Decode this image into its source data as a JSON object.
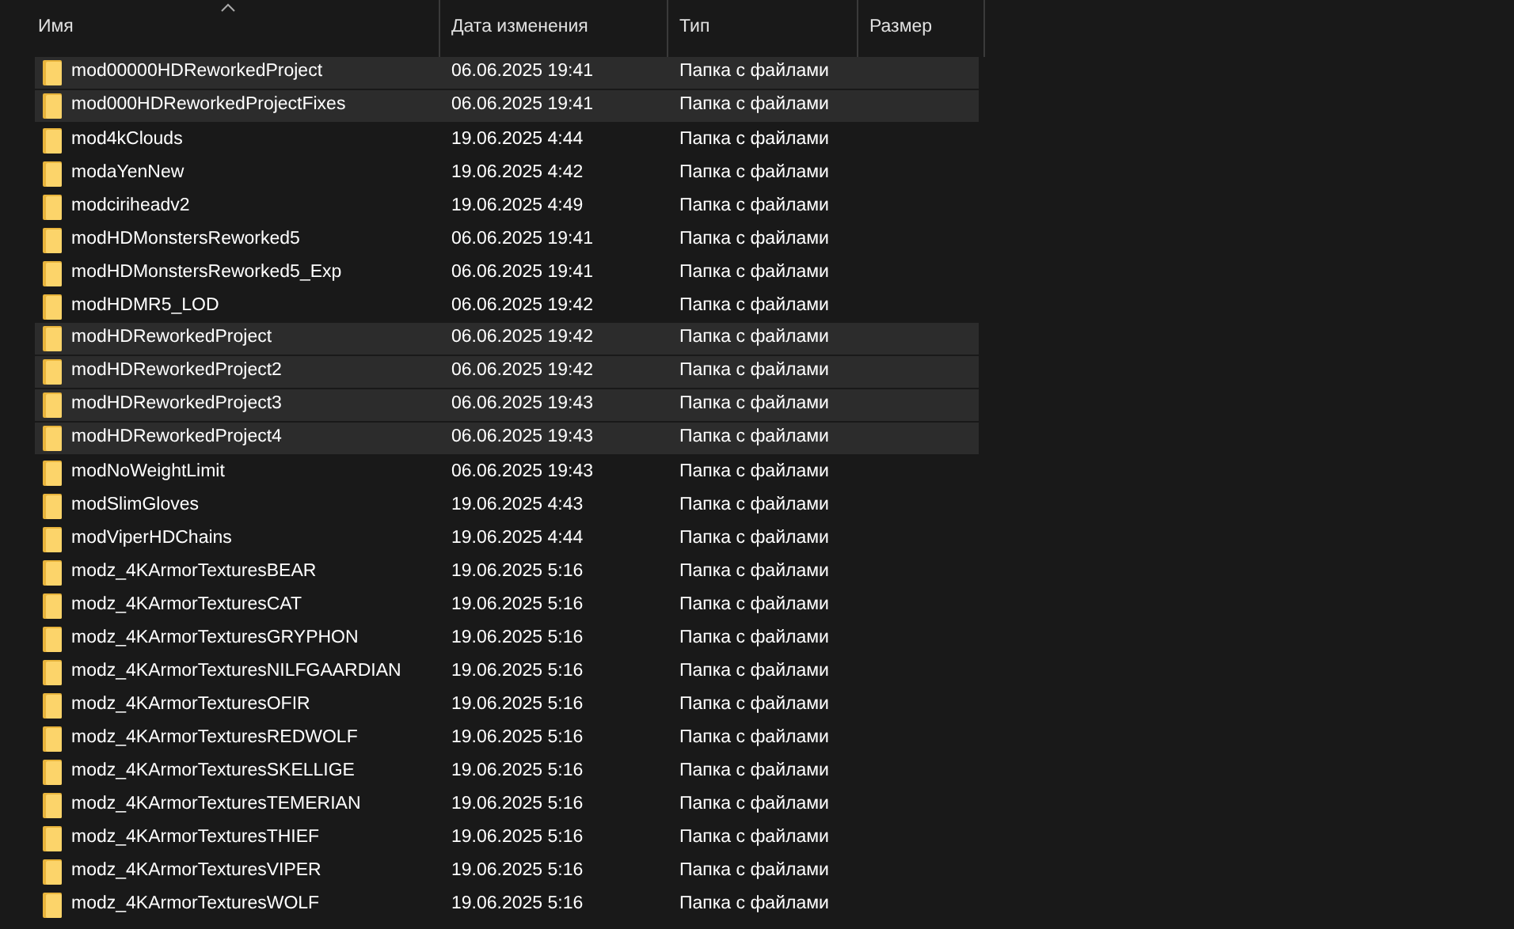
{
  "columns": [
    {
      "label": "Имя",
      "sorted": true
    },
    {
      "label": "Дата изменения",
      "sorted": false
    },
    {
      "label": "Тип",
      "sorted": false
    },
    {
      "label": "Размер",
      "sorted": false
    }
  ],
  "rows": [
    {
      "name": "mod00000HDReworkedProject",
      "date": "06.06.2025 19:41",
      "type": "Папка с файлами",
      "selected": true
    },
    {
      "name": "mod000HDReworkedProjectFixes",
      "date": "06.06.2025 19:41",
      "type": "Папка с файлами",
      "selected": true
    },
    {
      "name": "mod4kClouds",
      "date": "19.06.2025 4:44",
      "type": "Папка с файлами",
      "selected": false
    },
    {
      "name": "modaYenNew",
      "date": "19.06.2025 4:42",
      "type": "Папка с файлами",
      "selected": false
    },
    {
      "name": "modciriheadv2",
      "date": "19.06.2025 4:49",
      "type": "Папка с файлами",
      "selected": false
    },
    {
      "name": "modHDMonstersReworked5",
      "date": "06.06.2025 19:41",
      "type": "Папка с файлами",
      "selected": false
    },
    {
      "name": "modHDMonstersReworked5_Exp",
      "date": "06.06.2025 19:41",
      "type": "Папка с файлами",
      "selected": false
    },
    {
      "name": "modHDMR5_LOD",
      "date": "06.06.2025 19:42",
      "type": "Папка с файлами",
      "selected": false
    },
    {
      "name": "modHDReworkedProject",
      "date": "06.06.2025 19:42",
      "type": "Папка с файлами",
      "selected": true
    },
    {
      "name": "modHDReworkedProject2",
      "date": "06.06.2025 19:42",
      "type": "Папка с файлами",
      "selected": true
    },
    {
      "name": "modHDReworkedProject3",
      "date": "06.06.2025 19:43",
      "type": "Папка с файлами",
      "selected": true
    },
    {
      "name": "modHDReworkedProject4",
      "date": "06.06.2025 19:43",
      "type": "Папка с файлами",
      "selected": true
    },
    {
      "name": "modNoWeightLimit",
      "date": "06.06.2025 19:43",
      "type": "Папка с файлами",
      "selected": false
    },
    {
      "name": "modSlimGloves",
      "date": "19.06.2025 4:43",
      "type": "Папка с файлами",
      "selected": false
    },
    {
      "name": "modViperHDChains",
      "date": "19.06.2025 4:44",
      "type": "Папка с файлами",
      "selected": false
    },
    {
      "name": "modz_4KArmorTexturesBEAR",
      "date": "19.06.2025 5:16",
      "type": "Папка с файлами",
      "selected": false
    },
    {
      "name": "modz_4KArmorTexturesCAT",
      "date": "19.06.2025 5:16",
      "type": "Папка с файлами",
      "selected": false
    },
    {
      "name": "modz_4KArmorTexturesGRYPHON",
      "date": "19.06.2025 5:16",
      "type": "Папка с файлами",
      "selected": false
    },
    {
      "name": "modz_4KArmorTexturesNILFGAARDIAN",
      "date": "19.06.2025 5:16",
      "type": "Папка с файлами",
      "selected": false
    },
    {
      "name": "modz_4KArmorTexturesOFIR",
      "date": "19.06.2025 5:16",
      "type": "Папка с файлами",
      "selected": false
    },
    {
      "name": "modz_4KArmorTexturesREDWOLF",
      "date": "19.06.2025 5:16",
      "type": "Папка с файлами",
      "selected": false
    },
    {
      "name": "modz_4KArmorTexturesSKELLIGE",
      "date": "19.06.2025 5:16",
      "type": "Папка с файлами",
      "selected": false
    },
    {
      "name": "modz_4KArmorTexturesTEMERIAN",
      "date": "19.06.2025 5:16",
      "type": "Папка с файлами",
      "selected": false
    },
    {
      "name": "modz_4KArmorTexturesTHIEF",
      "date": "19.06.2025 5:16",
      "type": "Папка с файлами",
      "selected": false
    },
    {
      "name": "modz_4KArmorTexturesVIPER",
      "date": "19.06.2025 5:16",
      "type": "Папка с файлами",
      "selected": false
    },
    {
      "name": "modz_4KArmorTexturesWOLF",
      "date": "19.06.2025 5:16",
      "type": "Папка с файлами",
      "selected": false
    }
  ]
}
